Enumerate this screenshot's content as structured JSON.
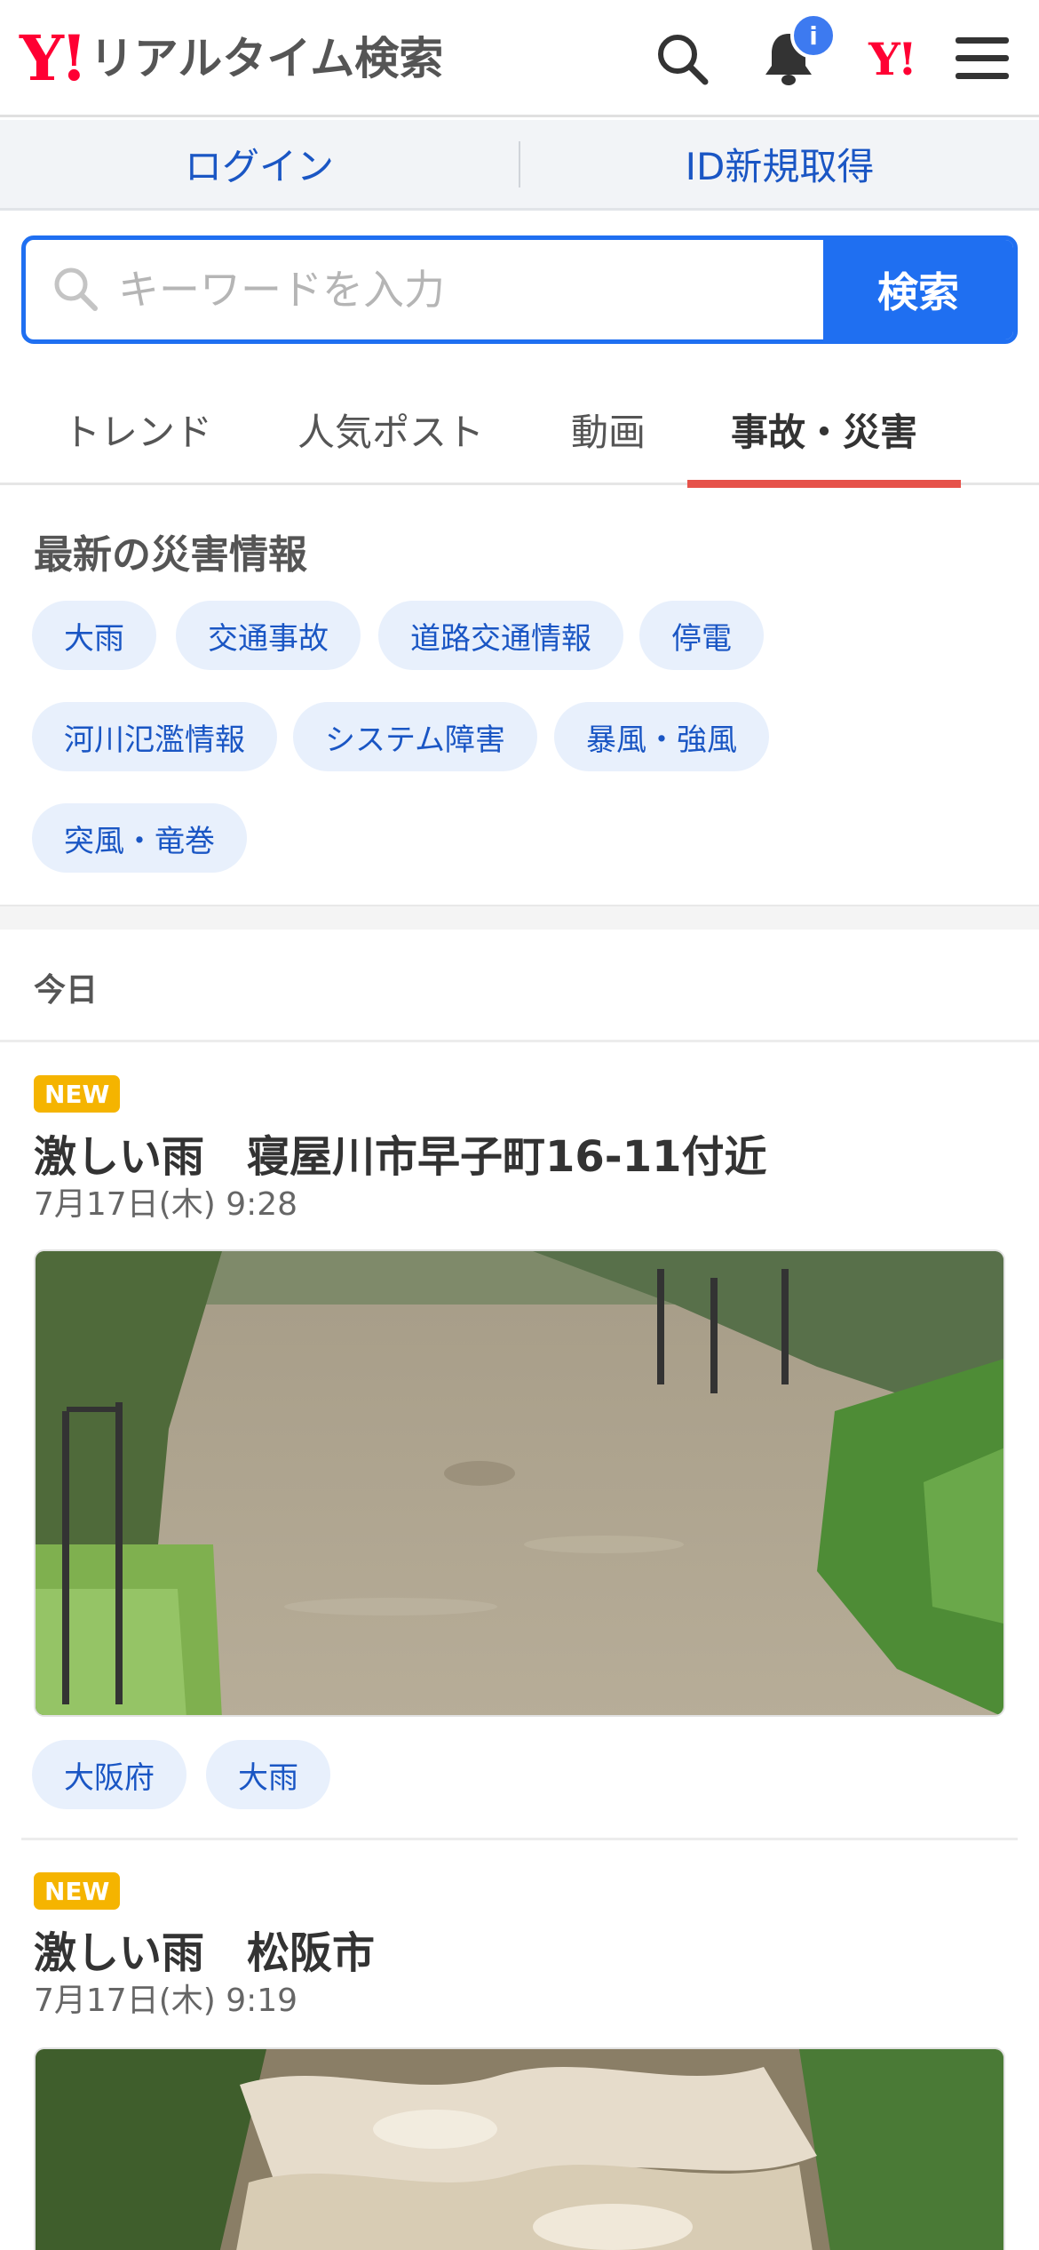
{
  "header": {
    "logo_mark": "Y!",
    "logo_text": "リアルタイム検索",
    "notification_badge": "i",
    "yahoo_mark": "Y!",
    "icons": [
      "search-icon",
      "bell-icon",
      "yahoo-logo-icon",
      "menu-icon"
    ]
  },
  "login_bar": {
    "login": "ログイン",
    "signup": "ID新規取得"
  },
  "search": {
    "placeholder": "キーワードを入力",
    "value": "",
    "button": "検索"
  },
  "tabs": [
    {
      "label": "トレンド",
      "active": false
    },
    {
      "label": "人気ポスト",
      "active": false
    },
    {
      "label": "動画",
      "active": false
    },
    {
      "label": "事故・災害",
      "active": true
    }
  ],
  "disaster_section": {
    "title": "最新の災害情報",
    "chips": [
      "大雨",
      "交通事故",
      "道路交通情報",
      "停電",
      "河川氾濫情報",
      "システム障害",
      "暴風・強風",
      "突風・竜巻"
    ]
  },
  "today_label": "今日",
  "posts": [
    {
      "badge": "NEW",
      "title": "激しい雨　寝屋川市早子町16-11付近",
      "date": "7月17日(木) 9:28",
      "tags": [
        "大阪府",
        "大雨"
      ]
    },
    {
      "badge": "NEW",
      "title": "激しい雨　松阪市",
      "date": "7月17日(木) 9:19",
      "tags": []
    }
  ],
  "colors": {
    "brand_red": "#ff0033",
    "accent_blue": "#1f6ff1",
    "link_blue": "#1a56c4",
    "tab_indicator": "#e6524a",
    "new_badge": "#f5b400"
  }
}
